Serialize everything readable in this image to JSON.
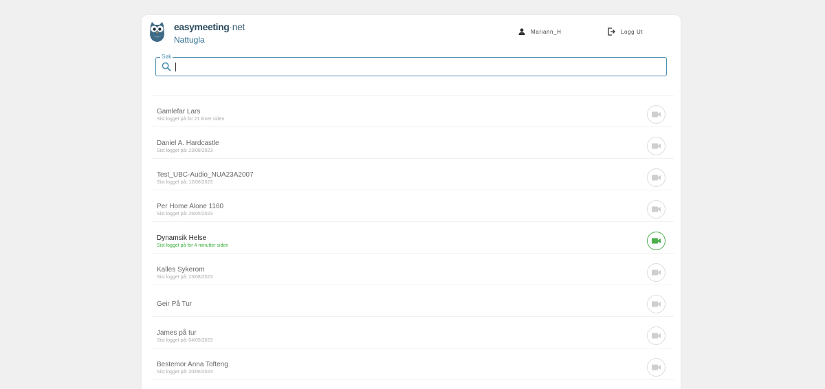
{
  "brand": {
    "name_bold": "easymeeting",
    "name_dot": "·",
    "name_suffix": "net",
    "site": "Nattugla"
  },
  "header": {
    "username": "Mariann_H",
    "logout_label": "Logg Ut"
  },
  "search": {
    "label": "Søk",
    "value": "",
    "placeholder": ""
  },
  "contacts": [
    {
      "name": "Gamlefar Lars",
      "last_login": "Sist logget på for 21 timer siden",
      "online": false
    },
    {
      "name": "Daniel A. Hardcastle",
      "last_login": "Sist logget på: 23/08/2023",
      "online": false
    },
    {
      "name": "Test_UBC-Audio_NUA23A2007",
      "last_login": "Sist logget på: 12/06/2023",
      "online": false
    },
    {
      "name": "Per Home Alone 1160",
      "last_login": "Sist logget på: 26/05/2023",
      "online": false
    },
    {
      "name": "Dynamsik Helse",
      "last_login": "Sist logget på for 4 minutter siden",
      "online": true
    },
    {
      "name": "Kalles Sykerom",
      "last_login": "Sist logget på: 23/08/2023",
      "online": false
    },
    {
      "name": "Geir På Tur",
      "last_login": "",
      "online": false
    },
    {
      "name": "James på tur",
      "last_login": "Sist logget på: 04/05/2023",
      "online": false
    },
    {
      "name": "Bestemor Anna Tofteng",
      "last_login": "Sist logget på: 20/06/2023",
      "online": false
    }
  ],
  "icons": {
    "logo": "owl-logo-icon",
    "user": "user-icon",
    "logout": "logout-icon",
    "search": "search-icon",
    "call": "video-camera-icon"
  },
  "colors": {
    "accent": "#4a90b0",
    "online": "#4cae4c",
    "offline_icon": "#cfcfcf",
    "background": "#f0f0f0",
    "brand_text": "#2f4f62"
  }
}
